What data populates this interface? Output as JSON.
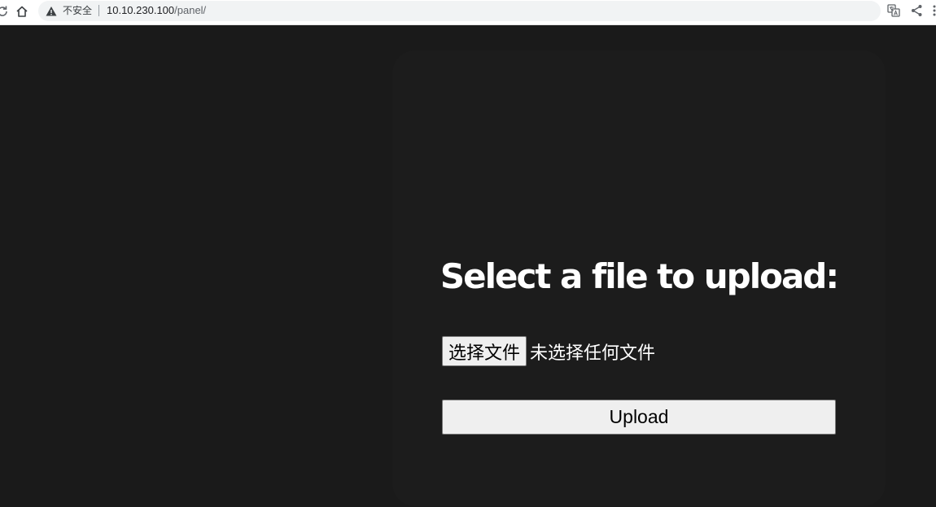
{
  "browser": {
    "security_label": "不安全",
    "url_host": "10.10.230.100",
    "url_path": "/panel/"
  },
  "icons": {
    "reload": "reload-icon",
    "home": "home-icon",
    "warning": "warning-icon",
    "translate": "translate-icon",
    "share": "share-icon",
    "more": "more-icon"
  },
  "upload_form": {
    "title": "Select a file to upload:",
    "choose_file_label": "选择文件",
    "no_file_text": "未选择任何文件",
    "upload_label": "Upload"
  },
  "colors": {
    "page_background": "#1a1a1a",
    "card_background": "#1c1c1c",
    "title_text": "#ffffff",
    "button_background": "#efefef"
  }
}
